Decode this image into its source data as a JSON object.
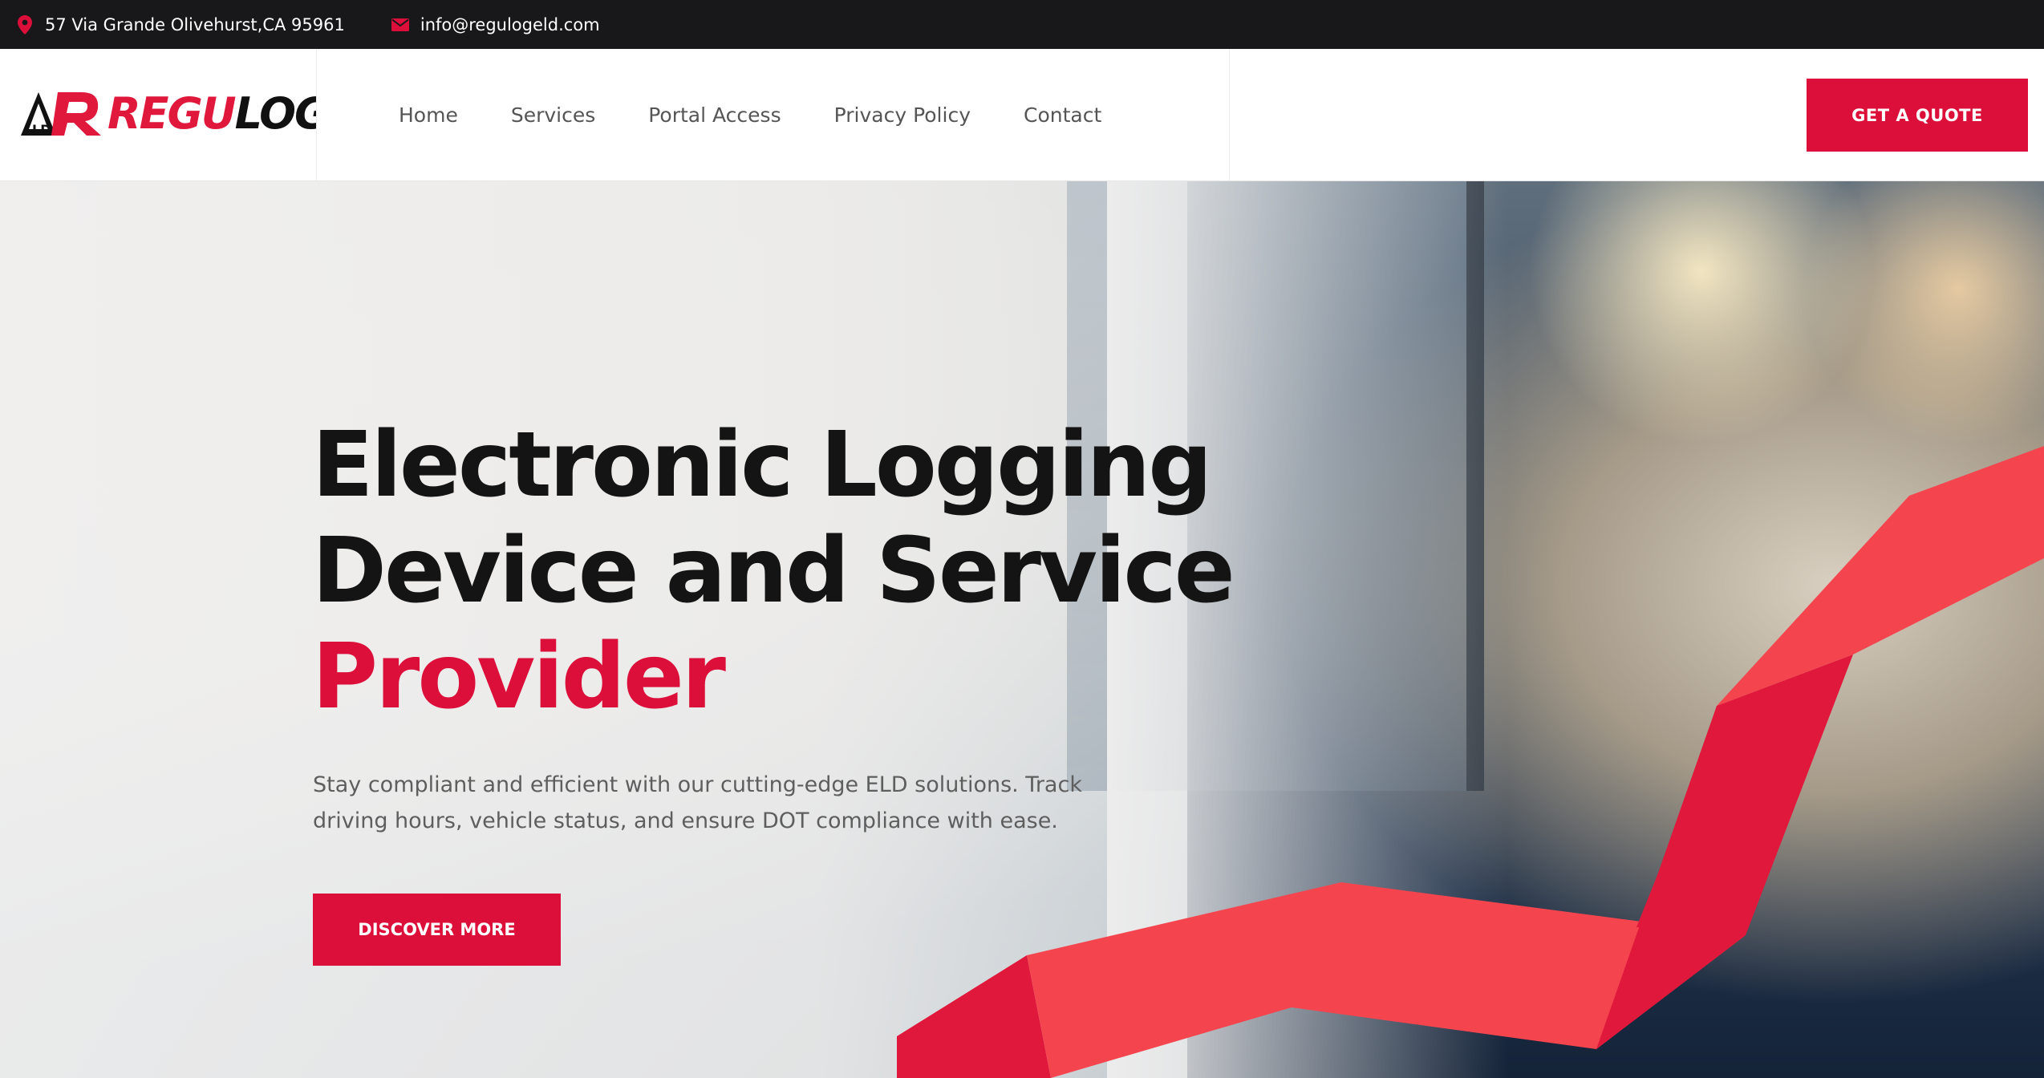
{
  "topbar": {
    "address": "57 Via Grande Olivehurst,CA 95961",
    "address_icon": "location-pin-icon",
    "email": "info@regulogeld.com",
    "email_icon": "envelope-icon"
  },
  "brand": {
    "logo_red": "REGU",
    "logo_dark": "LOG",
    "accent_color": "#dc0f3a"
  },
  "nav": {
    "items": [
      "Home",
      "Services",
      "Portal Access",
      "Privacy Policy",
      "Contact"
    ]
  },
  "header": {
    "cta_label": "GET A QUOTE"
  },
  "hero": {
    "title_line1": "Electronic Logging",
    "title_line2": "Device and Service",
    "title_accent": "Provider",
    "subtitle": "Stay compliant and efficient with our cutting-edge ELD solutions. Track driving hours, vehicle status, and ensure DOT compliance with ease.",
    "cta_label": "DISCOVER MORE"
  }
}
